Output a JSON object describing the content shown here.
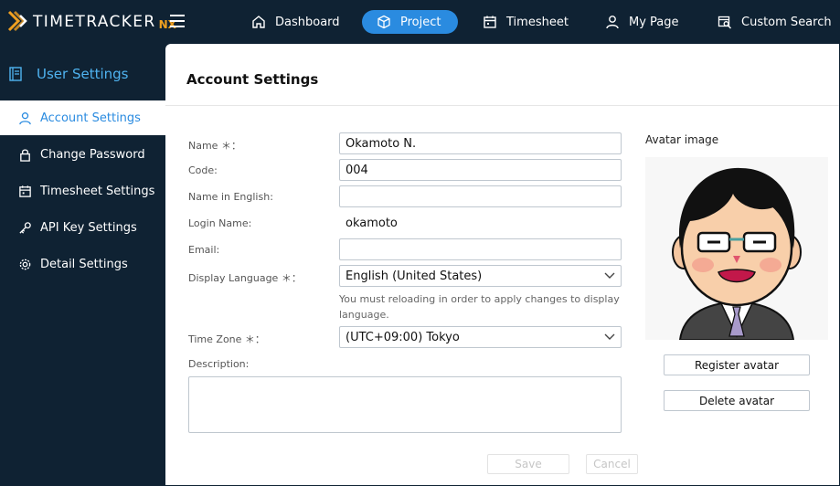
{
  "app": {
    "logo_text": "TIMETRACKER",
    "logo_suffix": "NX",
    "brand_color": "#f0a020",
    "accent_color": "#2a8be0"
  },
  "topnav": {
    "items": [
      {
        "label": "Dashboard",
        "icon": "home-icon",
        "active": false
      },
      {
        "label": "Project",
        "icon": "cube-icon",
        "active": true
      },
      {
        "label": "Timesheet",
        "icon": "calendar-icon",
        "active": false
      },
      {
        "label": "My Page",
        "icon": "user-icon",
        "active": false
      },
      {
        "label": "Custom Search",
        "icon": "search-calendar-icon",
        "active": false
      }
    ]
  },
  "sidebar": {
    "title": "User Settings",
    "items": [
      {
        "label": "Account Settings",
        "icon": "user-icon",
        "active": true
      },
      {
        "label": "Change Password",
        "icon": "lock-icon",
        "active": false
      },
      {
        "label": "Timesheet Settings",
        "icon": "calendar-icon",
        "active": false
      },
      {
        "label": "API Key Settings",
        "icon": "key-icon",
        "active": false
      },
      {
        "label": "Detail Settings",
        "icon": "gear-icon",
        "active": false
      }
    ]
  },
  "main": {
    "title": "Account Settings",
    "form": {
      "name_label": "Name ＊：",
      "name_value": "Okamoto N.",
      "code_label": "Code:",
      "code_value": "004",
      "name_en_label": "Name in English:",
      "name_en_value": "",
      "login_label": "Login Name:",
      "login_value": "okamoto",
      "email_label": "Email:",
      "email_value": "",
      "lang_label": "Display Language ＊：",
      "lang_value": "English (United States)",
      "lang_hint": "You must reloading in order to apply changes to display language.",
      "tz_label": "Time Zone ＊：",
      "tz_value": "(UTC+09:00) Tokyo",
      "desc_label": "Description:",
      "save_label": "Save",
      "cancel_label": "Cancel"
    },
    "avatar": {
      "label": "Avatar image",
      "register_label": "Register avatar",
      "delete_label": "Delete avatar"
    }
  }
}
